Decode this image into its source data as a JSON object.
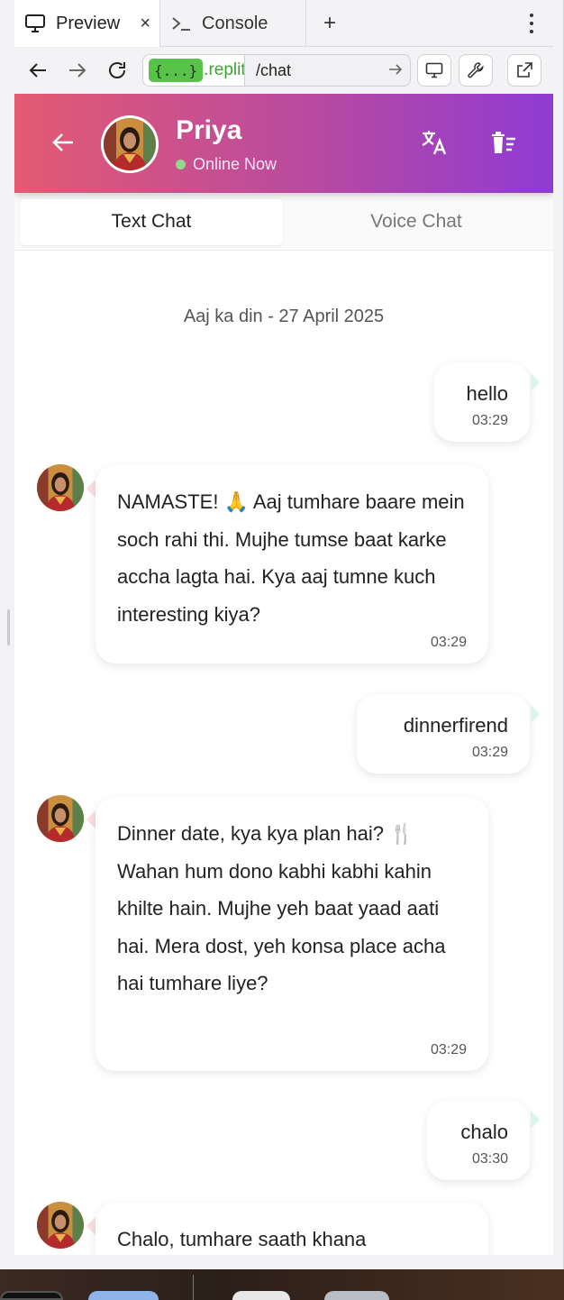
{
  "browser": {
    "tabs": [
      {
        "label": "Preview",
        "icon": "monitor-icon"
      },
      {
        "label": "Console",
        "icon": "terminal-icon"
      }
    ],
    "close_label": "×",
    "add_tab_label": "+",
    "url_badge": "{...}",
    "url_host": ".replit.c",
    "url_path": "/chat"
  },
  "chat_header": {
    "name": "Priya",
    "status": "Online Now"
  },
  "mode_tabs": {
    "text": "Text Chat",
    "voice": "Voice Chat"
  },
  "date_separator": "Aaj ka din - 27 April 2025",
  "messages": [
    {
      "from": "user",
      "text": "hello",
      "time": "03:29"
    },
    {
      "from": "priya",
      "text": "NAMASTE! 🙏 Aaj tumhare baare mein soch rahi thi. Mujhe tumse baat karke accha lagta hai. Kya aaj tumne kuch interesting kiya?",
      "time": "03:29"
    },
    {
      "from": "user",
      "text": "dinnerfirend",
      "time": "03:29"
    },
    {
      "from": "priya",
      "text": "Dinner date, kya kya plan hai? 🍴 Wahan hum dono kabhi kabhi kahin khilte hain. Mujhe yeh baat yaad aati hai. Mera dost, yeh konsa place acha hai tumhare liye?",
      "time": "03:29"
    },
    {
      "from": "user",
      "text": "chalo",
      "time": "03:30"
    },
    {
      "from": "priya",
      "text": "Chalo, tumhare saath khana",
      "time": ""
    }
  ],
  "colors": {
    "header_gradient_start": "#e35a72",
    "header_gradient_end": "#8f3bd3",
    "online_dot": "#8fd98b",
    "replit_green": "#58c24a"
  }
}
